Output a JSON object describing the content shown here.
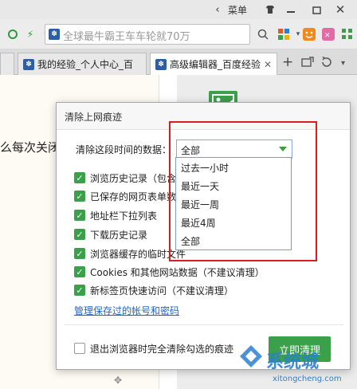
{
  "titlebar": {
    "menu_label": "菜单",
    "back_glyph": "‹",
    "icons": [
      "shirt-icon",
      "minimize-icon",
      "restore-icon",
      "close-icon"
    ]
  },
  "address": {
    "search_text": "全球最牛霸王车车轮就70万",
    "search_engine": "paw-icon"
  },
  "tabs": [
    {
      "label": "我的经验_个人中心_百",
      "active": false
    },
    {
      "label": "高级编辑器_百度经验",
      "active": true
    }
  ],
  "page": {
    "snippet": "么每次关闭"
  },
  "dialog": {
    "title": "清除上网痕迹",
    "range_label": "清除这段时间的数据：",
    "range_value": "全部",
    "options": [
      {
        "label": "浏览历史记录（包含",
        "checked": true
      },
      {
        "label": "已保存的网页表单数",
        "checked": true
      },
      {
        "label": "地址栏下拉列表",
        "checked": true
      },
      {
        "label": "下载历史记录",
        "checked": true
      },
      {
        "label": "浏览器缓存的临时文件",
        "checked": true
      },
      {
        "label": "Cookies 和其他网站数据（不建议清理）",
        "checked": true
      },
      {
        "label": "新标签页快速访问（不建议清理）",
        "checked": true
      }
    ],
    "manage_link": "管理保存过的帐号和密码",
    "exit_option": "退出浏览器时完全清除勾选的痕迹",
    "clear_button": "立即清理"
  },
  "dropdown": {
    "items": [
      "过去一小时",
      "最近一天",
      "最近一周",
      "最近4周",
      "全部"
    ]
  },
  "watermark": {
    "brand": "系统城",
    "url": "xitongcheng.com"
  },
  "colors": {
    "accent_green": "#3aa04a",
    "highlight_red": "#d81e1e",
    "link_blue": "#1f66c9"
  }
}
